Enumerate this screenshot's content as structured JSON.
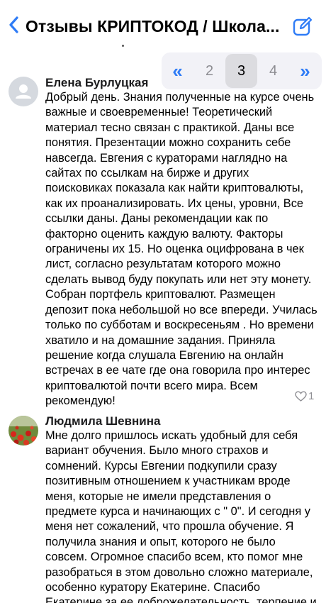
{
  "header": {
    "title": "Отзывы КРИПТОКОД / Школа..."
  },
  "pagination": {
    "first_label": "«",
    "pages": [
      "2",
      "3",
      "4"
    ],
    "current": "3",
    "next_label": "»"
  },
  "reviews": [
    {
      "author": "Елена Бурлуцкая",
      "lines": [
        "Добрый день. Знания полученные на курсе очень",
        "важные и своевременные!  Теоретический",
        "материал тесно связан с практикой. Даны все",
        "понятия. Презентации можно сохранить себе",
        "навсегда. Евгения с кураторами наглядно на",
        "сайтах по ссылкам на бирже и других",
        "поисковиках показала как найти криптовалюты,",
        "как их проанализировать. Их цены, уровни, Все",
        "ссылки даны. Даны рекомендации как по",
        "факторно оценить каждую валюту. Факторы",
        "ограничены их 15. Но оценка оцифрована в чек",
        "лист, согласно результатам которого можно",
        "сделать вывод буду покупать или нет эту монету.",
        "Собран портфель криптовалют. Размещен",
        "депозит пока небольшой но все впереди. Училась",
        "только по субботам и воскресеньям . Но времени",
        "хватило и на домашние задания. Приняла",
        "решение когда слушала Евгению на онлайн",
        "встречах в ее чате где она говорила про интерес",
        "криптовалютой почти всего мира. Всем",
        "рекомендую!"
      ],
      "likes": "1"
    },
    {
      "author": "Людмила Шевнина",
      "lines": [
        "Мне долго пришлось искать удобный для себя",
        "вариант обучения. Было много страхов и",
        "сомнений. Курсы Евгении подкупили сразу",
        "позитивным отношением к участникам вроде",
        "меня, которые не имели представления о",
        "предмете курса и начинающих с \" 0\". И сегодня у",
        "меня нет сожалений, что прошла обучение. Я",
        "получила знания и опыт, которого не было",
        "совсем. Огромное спасибо всем, кто помог мне",
        "разобраться в этом довольно сложно материале,",
        "особенно куратору Екатерине. Спасибо",
        "Екатерине за ее доброжелательность, терпение и"
      ]
    }
  ],
  "colors": {
    "accent": "#2f7cf6",
    "muted": "#8e8e93"
  }
}
